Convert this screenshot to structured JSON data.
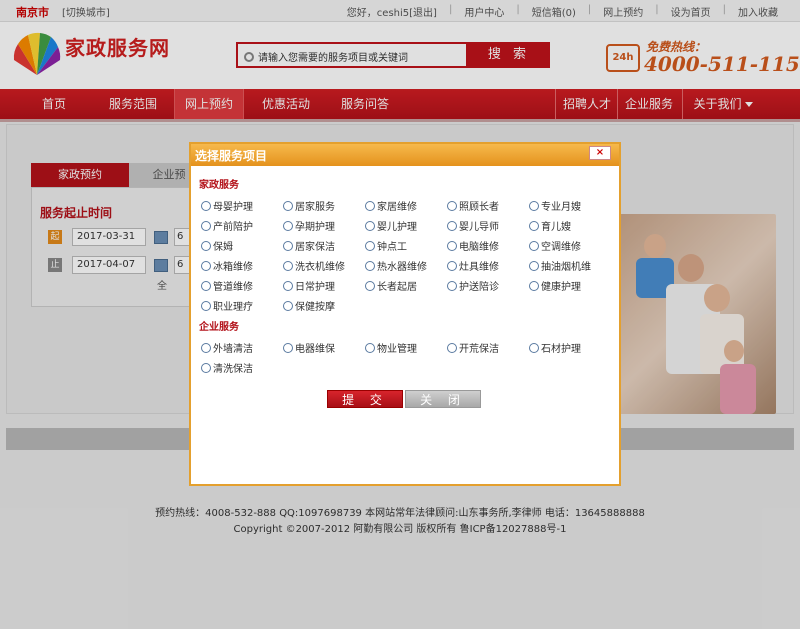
{
  "topbar": {
    "city": "南京市",
    "switch_city": "[切换城市]",
    "greeting": "您好，ceshi5",
    "logout": "[退出]",
    "links": [
      "用户中心",
      "短信箱(0)",
      "网上预约",
      "设为首页",
      "加入收藏"
    ]
  },
  "header": {
    "logo_text": "家政服务网",
    "search_placeholder": "请输入您需要的服务项目或关键词",
    "search_button": "搜 索",
    "hotline_icon": "24h",
    "hotline_label": "免费热线：",
    "hotline_number": "4000-511-115"
  },
  "nav": {
    "items": [
      "首页",
      "服务范围",
      "网上预约",
      "优惠活动",
      "服务问答"
    ],
    "right_items": [
      "招聘人才",
      "企业服务",
      "关于我们"
    ]
  },
  "booking": {
    "tabs": [
      "家政预约",
      "企业预"
    ],
    "panel_title": "服务起止时间",
    "start_tag": "起",
    "start_date": "2017-03-31",
    "end_tag": "止",
    "end_date": "2017-04-07",
    "time_frag": "6",
    "submit_frag": "全"
  },
  "footer": {
    "line1": "预约热线：4008-532-888  QQ:1097698739  本网站常年法律顾问:山东事务所,李律师  电话：13645888888",
    "line2": "Copyright ©2007-2012 阿勤有限公司  版权所有  鲁ICP备12027888号-1"
  },
  "modal": {
    "title": "选择服务项目",
    "close": "×",
    "home_section": "家政服务",
    "home_options": [
      "母婴护理",
      "居家服务",
      "家居维修",
      "照顾长者",
      "专业月嫂",
      "产前陪护",
      "孕期护理",
      "婴儿护理",
      "婴儿导师",
      "育儿嫂",
      "保姆",
      "居家保洁",
      "钟点工",
      "电脑维修",
      "空调维修",
      "冰箱维修",
      "洗衣机维修",
      "热水器维修",
      "灶具维修",
      "抽油烟机维",
      "管道维修",
      "日常护理",
      "长者起居",
      "护送陪诊",
      "健康护理",
      "职业理疗",
      "保健按摩"
    ],
    "business_section": "企业服务",
    "business_options": [
      "外墙清洁",
      "电器维保",
      "物业管理",
      "开荒保洁",
      "石材护理",
      "清洗保洁"
    ],
    "submit": "提 交",
    "cancel": "关 闭"
  },
  "colors": {
    "brand_red": "#c0131b",
    "orange": "#e4921d",
    "hotline_orange": "#d35a1e"
  }
}
